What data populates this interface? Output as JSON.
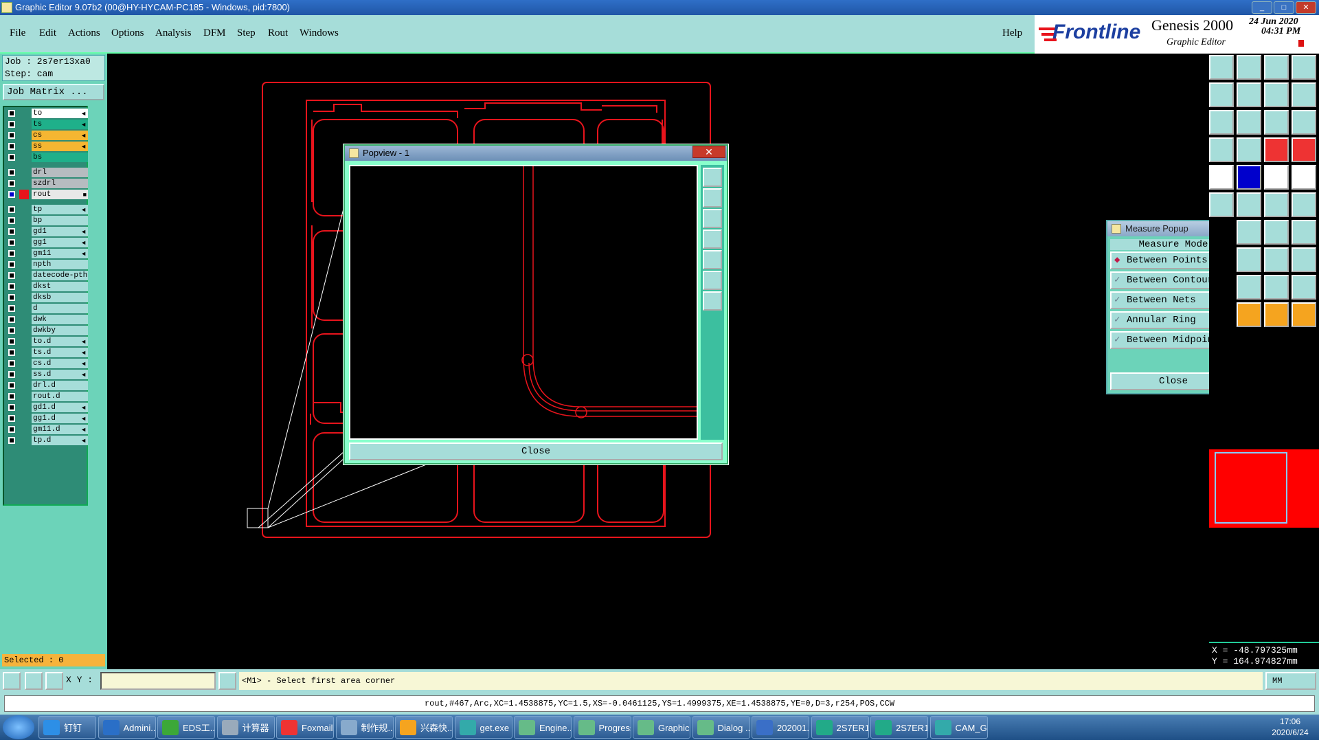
{
  "window": {
    "title": "Graphic Editor 9.07b2 (00@HY-HYCAM-PC185 - Windows, pid:7800)"
  },
  "menu": {
    "file": "File",
    "edit": "Edit",
    "actions": "Actions",
    "options": "Options",
    "analysis": "Analysis",
    "dfm": "DFM",
    "step": "Step",
    "rout": "Rout",
    "windows": "Windows",
    "help": "Help"
  },
  "brand": {
    "logo": "Frontline",
    "product": "Genesis 2000",
    "subtitle": "Graphic Editor",
    "date": "24 Jun 2020",
    "time": "04:31 PM"
  },
  "job": {
    "job_line": "Job : 2s7er13xa0",
    "step_line": "Step: cam",
    "matrix_button": "Job Matrix ..."
  },
  "layers": [
    {
      "name": "to",
      "color": "#ffffff",
      "mark": "◄"
    },
    {
      "name": "ts",
      "color": "#1fb08a",
      "mark": "◄"
    },
    {
      "name": "cs",
      "color": "#f5b632",
      "mark": "◄"
    },
    {
      "name": "ss",
      "color": "#f5b632",
      "mark": "◄"
    },
    {
      "name": "bs",
      "color": "#1fb08a",
      "mark": ""
    },
    {
      "name": "drl",
      "color": "#b6bcc0",
      "mark": ""
    },
    {
      "name": "szdrl",
      "color": "#b6bcc0",
      "mark": ""
    },
    {
      "name": "rout",
      "color": "#e8e8e8",
      "mark": "■"
    },
    {
      "name": "tp",
      "color": "#a6ddd9",
      "mark": "◄"
    },
    {
      "name": "bp",
      "color": "#a6ddd9",
      "mark": ""
    },
    {
      "name": "gd1",
      "color": "#a6ddd9",
      "mark": "◄"
    },
    {
      "name": "gg1",
      "color": "#a6ddd9",
      "mark": "◄"
    },
    {
      "name": "gm11",
      "color": "#a6ddd9",
      "mark": "◄"
    },
    {
      "name": "npth",
      "color": "#a6ddd9",
      "mark": ""
    },
    {
      "name": "datecode-pth",
      "color": "#a6ddd9",
      "mark": ""
    },
    {
      "name": "dkst",
      "color": "#a6ddd9",
      "mark": ""
    },
    {
      "name": "dksb",
      "color": "#a6ddd9",
      "mark": ""
    },
    {
      "name": "d",
      "color": "#a6ddd9",
      "mark": ""
    },
    {
      "name": "dwk",
      "color": "#a6ddd9",
      "mark": ""
    },
    {
      "name": "dwkby",
      "color": "#a6ddd9",
      "mark": ""
    },
    {
      "name": "to.d",
      "color": "#a6ddd9",
      "mark": "◄"
    },
    {
      "name": "ts.d",
      "color": "#a6ddd9",
      "mark": "◄"
    },
    {
      "name": "cs.d",
      "color": "#a6ddd9",
      "mark": "◄"
    },
    {
      "name": "ss.d",
      "color": "#a6ddd9",
      "mark": "◄"
    },
    {
      "name": "drl.d",
      "color": "#a6ddd9",
      "mark": ""
    },
    {
      "name": "rout.d",
      "color": "#a6ddd9",
      "mark": ""
    },
    {
      "name": "gd1.d",
      "color": "#a6ddd9",
      "mark": "◄"
    },
    {
      "name": "gg1.d",
      "color": "#a6ddd9",
      "mark": "◄"
    },
    {
      "name": "gm11.d",
      "color": "#a6ddd9",
      "mark": "◄"
    },
    {
      "name": "tp.d",
      "color": "#a6ddd9",
      "mark": "◄"
    }
  ],
  "selected": "Selected : 0",
  "popview": {
    "title": "Popview - 1",
    "close": "Close"
  },
  "measure": {
    "title": "Measure Popup",
    "heading": "Measure Mode",
    "options": [
      "Between Points",
      "Between Contours",
      "Between Nets",
      "Annular Ring",
      "Between Midpoints"
    ],
    "close": "Close"
  },
  "coords": {
    "x": "X = -48.797325mm",
    "y": "Y = 164.974827mm"
  },
  "status": {
    "xy_label": "X Y :",
    "xy_value": "",
    "message": "<M1> - Select first area corner",
    "units": "MM",
    "info": "rout,#467,Arc,XC=1.4538875,YC=1.5,XS=-0.0461125,YS=1.4999375,XE=1.4538875,YE=0,D=3,r254,POS,CCW"
  },
  "taskbar": {
    "items": [
      "钉钉",
      "Admini...",
      "EDS工...",
      "计算器",
      "Foxmail",
      "制作规...",
      "兴森快...",
      "get.exe",
      "Engine...",
      "Progress",
      "Graphic...",
      "Dialog ...",
      "202001...",
      "2S7ER1...",
      "2S7ER1...",
      "CAM_G..."
    ],
    "time": "17:06",
    "date": "2020/6/24"
  },
  "colors": {
    "rout": "#e8141c",
    "panel": "#a6ddd9",
    "canvas": "#000000"
  }
}
